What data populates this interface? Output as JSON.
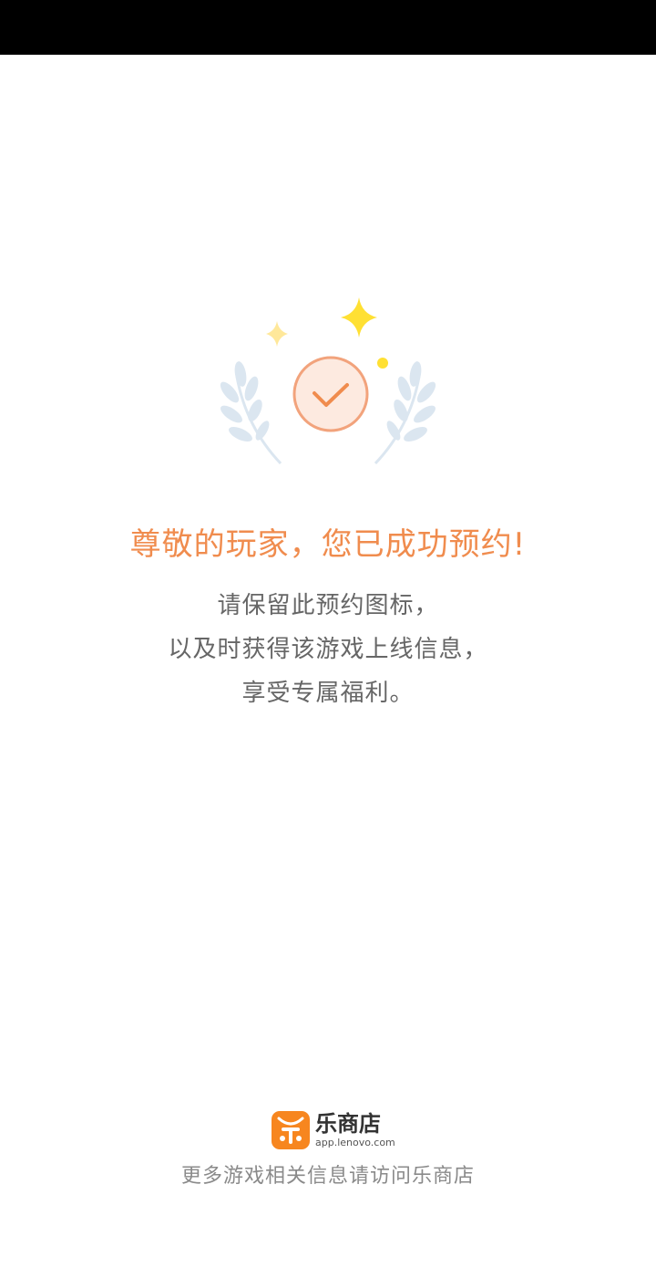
{
  "colors": {
    "accent": "#f08c4e",
    "body_text": "#666666",
    "footer_text": "#8a8a8a",
    "sparkle": "#ffe033",
    "laurel": "#dbe6f0",
    "status_bar": "#000000",
    "logo_orange": "#f7861f"
  },
  "illustration": {
    "icon": "check-badge-icon"
  },
  "title": "尊敬的玩家，您已成功预约!",
  "message": {
    "lines": [
      "请保留此预约图标，",
      "以及时获得该游戏上线信息，",
      "享受专属福利。"
    ]
  },
  "store": {
    "name": "乐商店",
    "url": "app.lenovo.com",
    "logo_icon": "le-store-logo-icon"
  },
  "footer": {
    "text": "更多游戏相关信息请访问乐商店"
  }
}
